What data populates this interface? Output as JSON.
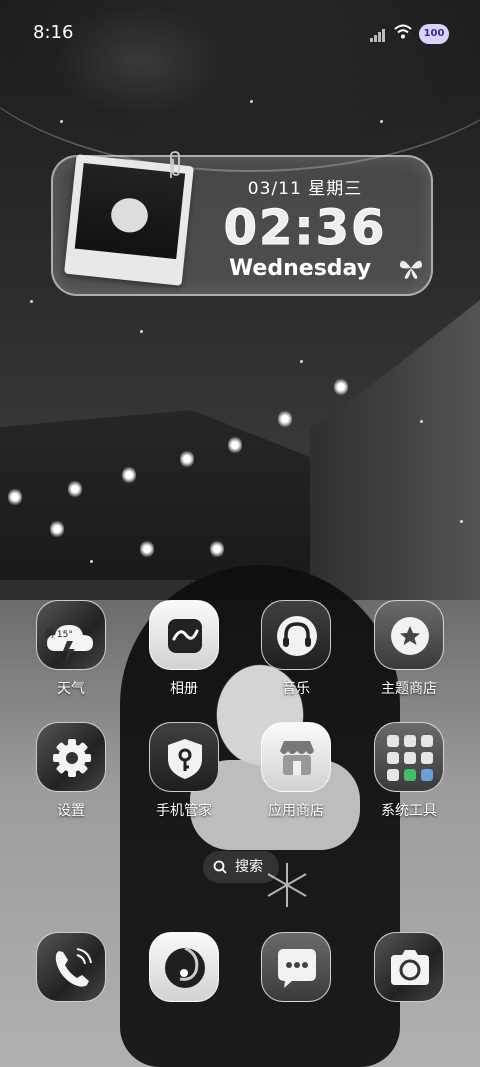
{
  "status_bar": {
    "time": "8:16",
    "battery": "100"
  },
  "widget": {
    "date_line": "03/11  星期三",
    "time": "02:36",
    "weekday": "Wednesday"
  },
  "apps": {
    "weather": {
      "label": "天气",
      "badge": "阴 15°"
    },
    "gallery": {
      "label": "相册"
    },
    "music": {
      "label": "音乐"
    },
    "theme_store": {
      "label": "主题商店"
    },
    "settings": {
      "label": "设置"
    },
    "security": {
      "label": "手机管家"
    },
    "app_store": {
      "label": "应用商店"
    },
    "system_tools": {
      "label": "系统工具"
    }
  },
  "search": {
    "label": "搜索"
  },
  "dock": [
    "phone",
    "browser",
    "messages",
    "camera"
  ]
}
